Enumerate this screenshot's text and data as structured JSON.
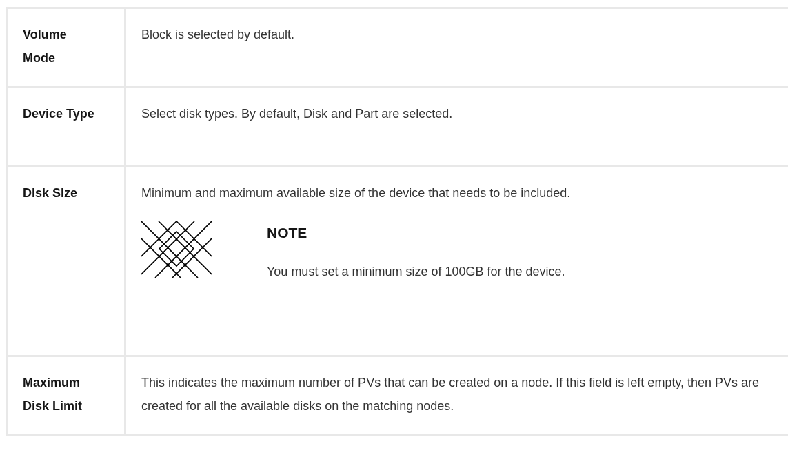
{
  "table": {
    "rows": [
      {
        "term": "Volume Mode",
        "description": "Block is selected by default."
      },
      {
        "term": "Device Type",
        "description": "Select disk types. By default, Disk and Part are selected."
      },
      {
        "term": "Disk Size",
        "description": "Minimum and maximum available size of the device that needs to be included.",
        "note": {
          "heading": "NOTE",
          "text": "You must set a minimum size of 100GB for the device."
        }
      },
      {
        "term": "Maximum Disk Limit",
        "description": "This indicates the maximum number of PVs that can be created on a node. If this field is left empty, then PVs are created for all the available disks on the matching nodes."
      }
    ]
  }
}
